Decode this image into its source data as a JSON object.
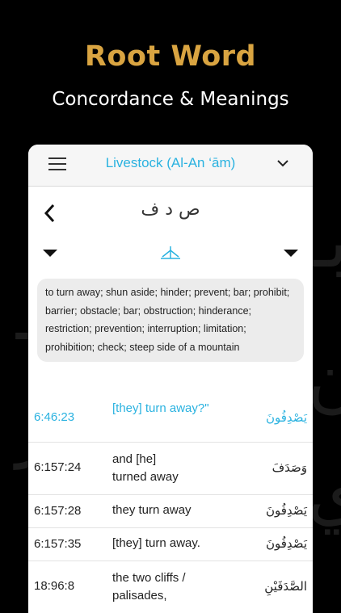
{
  "promo": {
    "headline": "Root Word",
    "subheadline": "Concordance & Meanings",
    "background_calligraphy": "القسط وهو لا يظن ت والأرض الا إن"
  },
  "topbar": {
    "menu_icon": "hamburger-icon",
    "surah_title": "Livestock (Al-An ‘ām)",
    "dropdown_icon": "chevron-down-icon"
  },
  "root": {
    "back_icon": "chevron-left-icon",
    "letters": "ص د ف",
    "prev_icon": "triangle-down-icon",
    "tree_icon": "root-tree-icon",
    "next_icon": "triangle-down-icon"
  },
  "meaning": "to turn away; shun aside; hinder; prevent; bar; prohibit; barrier; obstacle; bar; obstruction; hinderance; restriction; prevention; interruption; limitation; prohibition; check; steep side of a mountain",
  "occurrences": [
    {
      "ref": "6:46:23",
      "gloss": "[they] turn away?\"",
      "arabic": "يَصْدِفُونَ",
      "active": true
    },
    {
      "ref": "6:157:24",
      "gloss": "and [he] turned away",
      "arabic": "وَصَدَفَ",
      "active": false
    },
    {
      "ref": "6:157:28",
      "gloss": "they turn away",
      "arabic": "يَصْدِفُونَ",
      "active": false
    },
    {
      "ref": "6:157:35",
      "gloss": "[they] turn away.",
      "arabic": "يَصْدِفُونَ",
      "active": false
    },
    {
      "ref": "18:96:8",
      "gloss": "the two cliffs / palisades,",
      "arabic": "الصَّدَفَيْنِ",
      "active": false
    }
  ],
  "colors": {
    "accent": "#2ab2e0",
    "headline_gold": "#d9a441",
    "background": "#000000"
  }
}
